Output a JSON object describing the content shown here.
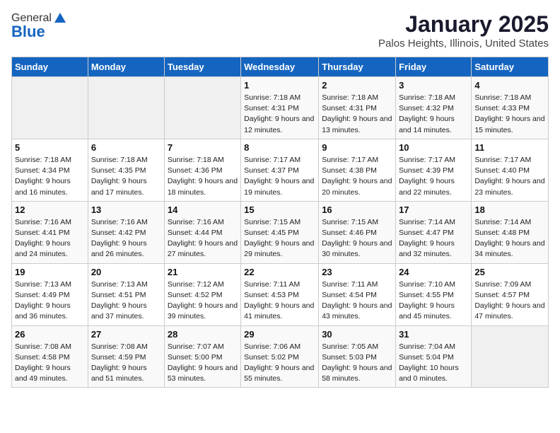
{
  "header": {
    "logo_general": "General",
    "logo_blue": "Blue",
    "title": "January 2025",
    "subtitle": "Palos Heights, Illinois, United States"
  },
  "weekdays": [
    "Sunday",
    "Monday",
    "Tuesday",
    "Wednesday",
    "Thursday",
    "Friday",
    "Saturday"
  ],
  "weeks": [
    [
      {
        "day": "",
        "info": ""
      },
      {
        "day": "",
        "info": ""
      },
      {
        "day": "",
        "info": ""
      },
      {
        "day": "1",
        "info": "Sunrise: 7:18 AM\nSunset: 4:31 PM\nDaylight: 9 hours and 12 minutes."
      },
      {
        "day": "2",
        "info": "Sunrise: 7:18 AM\nSunset: 4:31 PM\nDaylight: 9 hours and 13 minutes."
      },
      {
        "day": "3",
        "info": "Sunrise: 7:18 AM\nSunset: 4:32 PM\nDaylight: 9 hours and 14 minutes."
      },
      {
        "day": "4",
        "info": "Sunrise: 7:18 AM\nSunset: 4:33 PM\nDaylight: 9 hours and 15 minutes."
      }
    ],
    [
      {
        "day": "5",
        "info": "Sunrise: 7:18 AM\nSunset: 4:34 PM\nDaylight: 9 hours and 16 minutes."
      },
      {
        "day": "6",
        "info": "Sunrise: 7:18 AM\nSunset: 4:35 PM\nDaylight: 9 hours and 17 minutes."
      },
      {
        "day": "7",
        "info": "Sunrise: 7:18 AM\nSunset: 4:36 PM\nDaylight: 9 hours and 18 minutes."
      },
      {
        "day": "8",
        "info": "Sunrise: 7:17 AM\nSunset: 4:37 PM\nDaylight: 9 hours and 19 minutes."
      },
      {
        "day": "9",
        "info": "Sunrise: 7:17 AM\nSunset: 4:38 PM\nDaylight: 9 hours and 20 minutes."
      },
      {
        "day": "10",
        "info": "Sunrise: 7:17 AM\nSunset: 4:39 PM\nDaylight: 9 hours and 22 minutes."
      },
      {
        "day": "11",
        "info": "Sunrise: 7:17 AM\nSunset: 4:40 PM\nDaylight: 9 hours and 23 minutes."
      }
    ],
    [
      {
        "day": "12",
        "info": "Sunrise: 7:16 AM\nSunset: 4:41 PM\nDaylight: 9 hours and 24 minutes."
      },
      {
        "day": "13",
        "info": "Sunrise: 7:16 AM\nSunset: 4:42 PM\nDaylight: 9 hours and 26 minutes."
      },
      {
        "day": "14",
        "info": "Sunrise: 7:16 AM\nSunset: 4:44 PM\nDaylight: 9 hours and 27 minutes."
      },
      {
        "day": "15",
        "info": "Sunrise: 7:15 AM\nSunset: 4:45 PM\nDaylight: 9 hours and 29 minutes."
      },
      {
        "day": "16",
        "info": "Sunrise: 7:15 AM\nSunset: 4:46 PM\nDaylight: 9 hours and 30 minutes."
      },
      {
        "day": "17",
        "info": "Sunrise: 7:14 AM\nSunset: 4:47 PM\nDaylight: 9 hours and 32 minutes."
      },
      {
        "day": "18",
        "info": "Sunrise: 7:14 AM\nSunset: 4:48 PM\nDaylight: 9 hours and 34 minutes."
      }
    ],
    [
      {
        "day": "19",
        "info": "Sunrise: 7:13 AM\nSunset: 4:49 PM\nDaylight: 9 hours and 36 minutes."
      },
      {
        "day": "20",
        "info": "Sunrise: 7:13 AM\nSunset: 4:51 PM\nDaylight: 9 hours and 37 minutes."
      },
      {
        "day": "21",
        "info": "Sunrise: 7:12 AM\nSunset: 4:52 PM\nDaylight: 9 hours and 39 minutes."
      },
      {
        "day": "22",
        "info": "Sunrise: 7:11 AM\nSunset: 4:53 PM\nDaylight: 9 hours and 41 minutes."
      },
      {
        "day": "23",
        "info": "Sunrise: 7:11 AM\nSunset: 4:54 PM\nDaylight: 9 hours and 43 minutes."
      },
      {
        "day": "24",
        "info": "Sunrise: 7:10 AM\nSunset: 4:55 PM\nDaylight: 9 hours and 45 minutes."
      },
      {
        "day": "25",
        "info": "Sunrise: 7:09 AM\nSunset: 4:57 PM\nDaylight: 9 hours and 47 minutes."
      }
    ],
    [
      {
        "day": "26",
        "info": "Sunrise: 7:08 AM\nSunset: 4:58 PM\nDaylight: 9 hours and 49 minutes."
      },
      {
        "day": "27",
        "info": "Sunrise: 7:08 AM\nSunset: 4:59 PM\nDaylight: 9 hours and 51 minutes."
      },
      {
        "day": "28",
        "info": "Sunrise: 7:07 AM\nSunset: 5:00 PM\nDaylight: 9 hours and 53 minutes."
      },
      {
        "day": "29",
        "info": "Sunrise: 7:06 AM\nSunset: 5:02 PM\nDaylight: 9 hours and 55 minutes."
      },
      {
        "day": "30",
        "info": "Sunrise: 7:05 AM\nSunset: 5:03 PM\nDaylight: 9 hours and 58 minutes."
      },
      {
        "day": "31",
        "info": "Sunrise: 7:04 AM\nSunset: 5:04 PM\nDaylight: 10 hours and 0 minutes."
      },
      {
        "day": "",
        "info": ""
      }
    ]
  ]
}
